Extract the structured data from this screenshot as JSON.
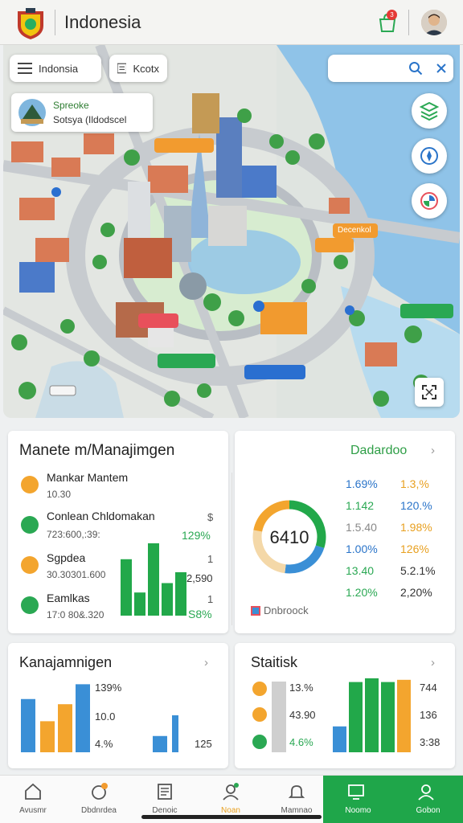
{
  "header": {
    "title": "Indonesia",
    "notification_count": "3"
  },
  "map": {
    "menu_chip": "Indonsia",
    "layer_chip": "Kcotx",
    "info_card": {
      "title": "Spreoke",
      "subtitle": "Sotsya (Ildodscel"
    },
    "labels": [
      {
        "text": "",
        "color": "#f29b2f"
      },
      {
        "text": "Decenkol",
        "color": "#f29b2f"
      },
      {
        "text": "",
        "color": "#f29b2f"
      },
      {
        "text": "",
        "color": "#e8505b"
      },
      {
        "text": "",
        "color": "#2aa853"
      },
      {
        "text": "",
        "color": "#2a6fd0"
      },
      {
        "text": "",
        "color": "#2aa853"
      }
    ]
  },
  "manage_card": {
    "title": "Manete m/Manajimgen",
    "items": [
      {
        "name": "Mankar Mantem",
        "sub": "10.30",
        "icon_color": "#f3a52e"
      },
      {
        "name": "Conlean Chldomakan",
        "sub": "723:600,:39:",
        "icon_color": "#2aa853",
        "value": "129%",
        "aux": "$"
      },
      {
        "name": "Sgpdea",
        "sub": "30.30301.600",
        "icon_color": "#f3a52e",
        "aux": "1"
      },
      {
        "name": "Eamlkas",
        "sub": "17:0 80&.320",
        "icon_color": "#2aa853",
        "value": "S8%",
        "aux": "1"
      }
    ],
    "bar_value": "2,590",
    "bars": [
      0.78,
      0.32,
      1.0,
      0.45,
      0.6
    ],
    "bar_color": "#22a84a"
  },
  "dashboard_card": {
    "link": "Dadardoo",
    "gauge_value": "6410",
    "gauge_segments": [
      {
        "fraction": 0.3,
        "color": "#22a84a"
      },
      {
        "fraction": 0.22,
        "color": "#3a8fd6"
      },
      {
        "fraction": 0.26,
        "color": "#f4d8a8"
      },
      {
        "fraction": 0.22,
        "color": "#f3a52e"
      }
    ],
    "footer": "Dnbroock",
    "rows": [
      {
        "a": "1.69%",
        "b": "1.3,%",
        "a_color": "#2a74c9",
        "b_color": "#e8a020"
      },
      {
        "a": "1.142",
        "b": "120.%",
        "a_color": "#2aa853",
        "b_color": "#2a74c9"
      },
      {
        "a": "1.5.40",
        "b": "1.98%",
        "a_color": "#888888",
        "b_color": "#e8a020"
      },
      {
        "a": "1.00%",
        "b": "126%",
        "a_color": "#2a74c9",
        "b_color": "#e8a020"
      },
      {
        "a": "13.40",
        "b": "5.2.1%",
        "a_color": "#2aa853",
        "b_color": "#333333"
      },
      {
        "a": "1.20%",
        "b": "2,20%",
        "a_color": "#2aa853",
        "b_color": "#333333"
      }
    ]
  },
  "kanaj_card": {
    "title": "Kanajamnigen",
    "stats": [
      "139%",
      "10.0",
      "4.%"
    ],
    "small_value": "125",
    "bars": [
      {
        "value": 0.72,
        "color": "#3a8fd6"
      },
      {
        "value": 0.42,
        "color": "#f3a52e"
      },
      {
        "value": 0.65,
        "color": "#f3a52e"
      },
      {
        "value": 0.92,
        "color": "#3a8fd6"
      },
      {
        "value": 0.22,
        "color": "#3a8fd6"
      },
      {
        "value": 0.5,
        "color": "#3a8fd6"
      }
    ]
  },
  "statistik_card": {
    "title": "Staitisk",
    "stats": [
      {
        "text": "13.%",
        "icon_color": "#f3a52e"
      },
      {
        "text": "43.90",
        "icon_color": "#f3a52e"
      },
      {
        "text": "4.6%",
        "icon_color": "#2aa853"
      }
    ],
    "right_values": [
      "744",
      "136",
      "3:38"
    ],
    "bars": [
      {
        "value": 0.35,
        "color": "#3a8fd6"
      },
      {
        "value": 0.95,
        "color": "#22a84a"
      },
      {
        "value": 1.0,
        "color": "#22a84a"
      },
      {
        "value": 0.95,
        "color": "#22a84a"
      },
      {
        "value": 0.98,
        "color": "#f3a52e"
      }
    ]
  },
  "tabbar": {
    "tabs": [
      {
        "label": "Avusmr",
        "icon": "home-icon",
        "active": false
      },
      {
        "label": "Dbdnrdea",
        "icon": "alert-icon",
        "active": false
      },
      {
        "label": "Denoic",
        "icon": "document-icon",
        "active": false
      },
      {
        "label": "Noan",
        "icon": "user-icon",
        "active": false
      },
      {
        "label": "Mamnao",
        "icon": "bell-icon",
        "active": false
      },
      {
        "label": "Noomo",
        "icon": "monitor-icon",
        "active": true
      },
      {
        "label": "Gobon",
        "icon": "profile-icon",
        "active": true
      }
    ]
  }
}
